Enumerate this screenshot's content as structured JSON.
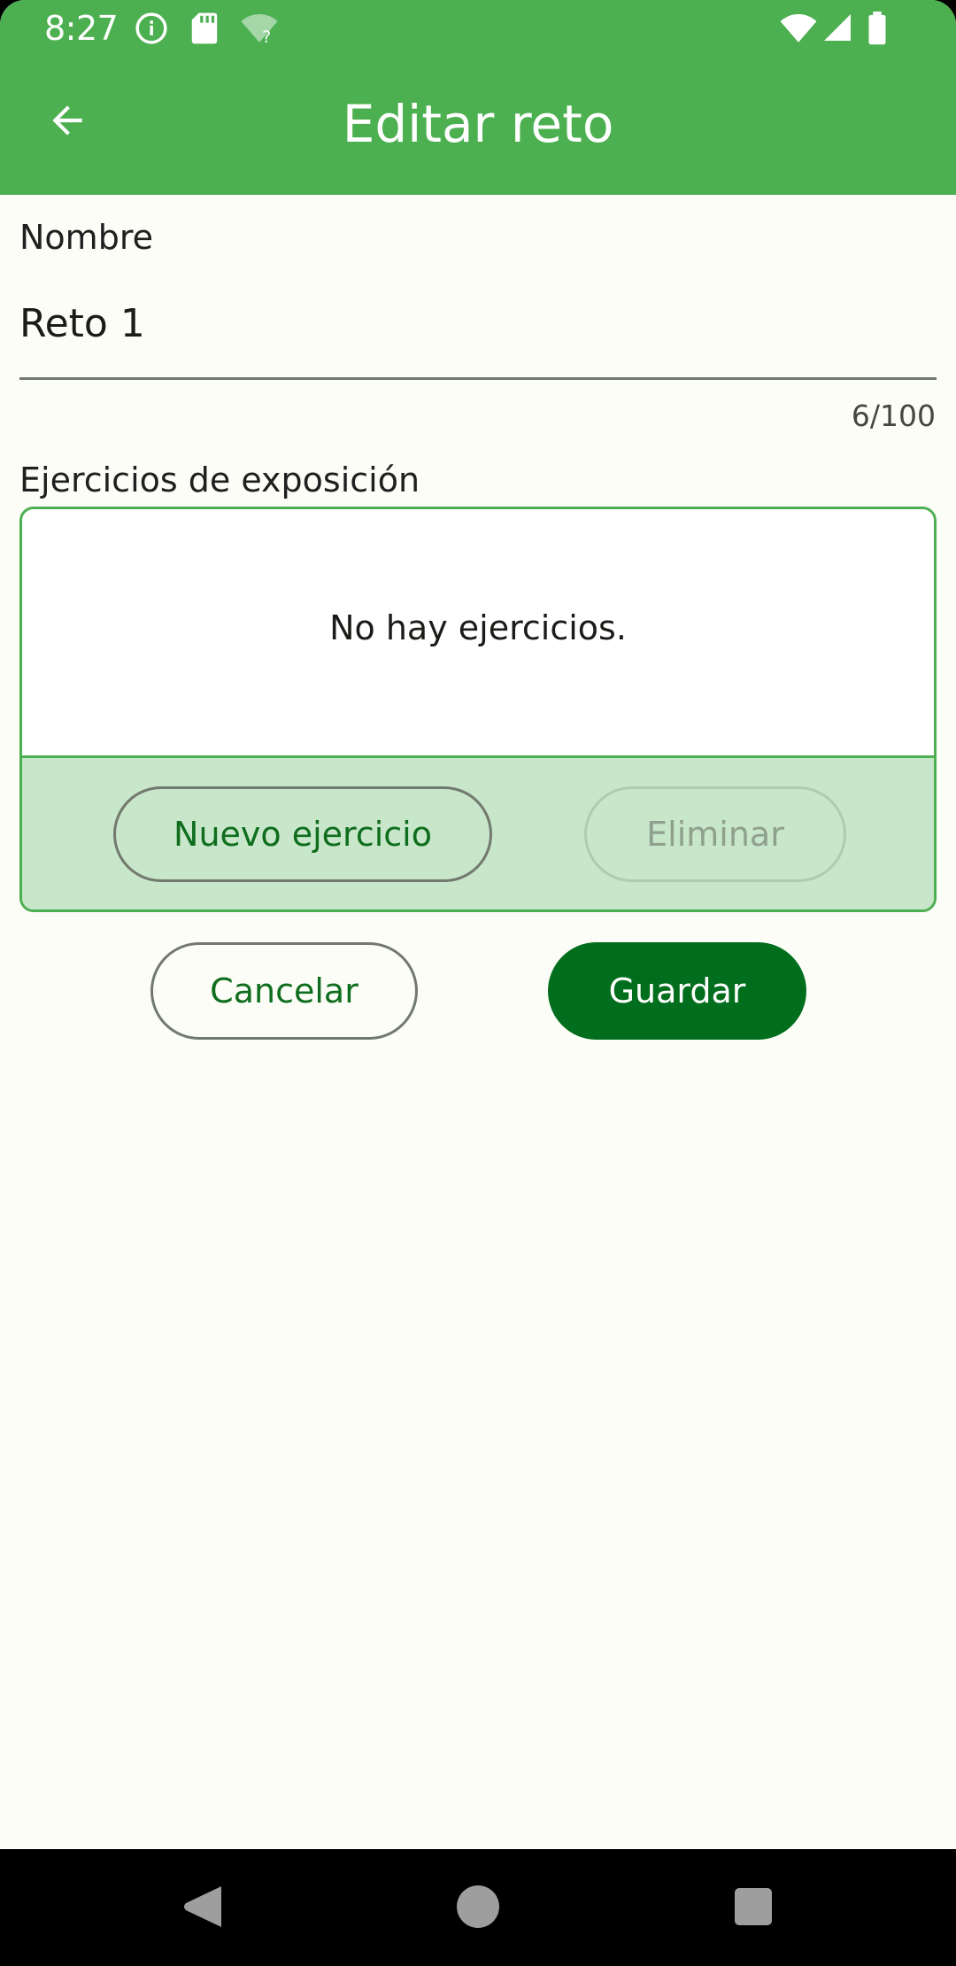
{
  "status_bar": {
    "time": "8:27",
    "icons": [
      "info-icon",
      "sd-card-icon",
      "wifi-question-icon",
      "wifi-icon",
      "signal-icon",
      "battery-icon"
    ]
  },
  "app_bar": {
    "title": "Editar reto",
    "back_icon": "arrow-back-icon"
  },
  "form": {
    "name_label": "Nombre",
    "name_value": "Reto 1",
    "name_counter": "6/100",
    "exercises_label": "Ejercicios de exposición",
    "exercises_empty": "No hay ejercicios.",
    "new_exercise_label": "Nuevo ejercicio",
    "delete_label": "Eliminar",
    "cancel_label": "Cancelar",
    "save_label": "Guardar"
  },
  "colors": {
    "primary": "#4CAF50",
    "primary_dark": "#006E1C",
    "tonal": "#C8E6C9",
    "background": "#FCFDF7"
  },
  "nav_bar": {
    "icons": [
      "back-triangle-icon",
      "home-circle-icon",
      "recents-square-icon"
    ]
  }
}
